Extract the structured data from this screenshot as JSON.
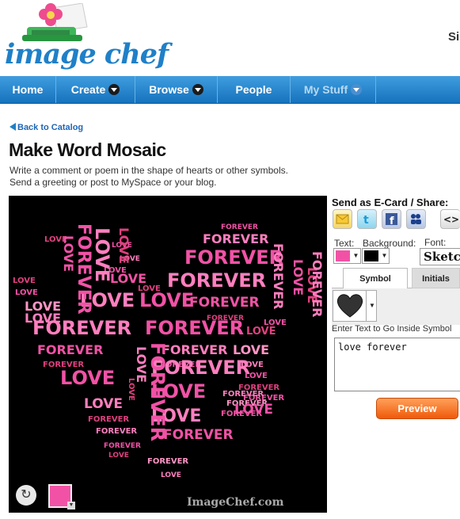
{
  "brand": {
    "logo_text": "image chef"
  },
  "header": {
    "signin_partial": "Si"
  },
  "nav": {
    "items": [
      {
        "label": "Home",
        "has_menu": false
      },
      {
        "label": "Create",
        "has_menu": true
      },
      {
        "label": "Browse",
        "has_menu": true
      },
      {
        "label": "People",
        "has_menu": false
      },
      {
        "label": "My Stuff",
        "has_menu": true
      }
    ]
  },
  "page": {
    "back_link": "Back to Catalog",
    "title": "Make Word Mosaic",
    "description_line1": "Write a comment or poem in the shape of hearts or other symbols.",
    "description_line2": "Send a greeting or post to MySpace or your blog."
  },
  "mosaic": {
    "background_color": "#000000",
    "text_color": "#f252a6",
    "words": [
      "LOVE",
      "FOREVER"
    ],
    "watermark": "ImageChef.com",
    "rotate_icon": "refresh-icon"
  },
  "panel": {
    "send_label": "Send as E-Card / Share:",
    "share_icons": [
      "email-icon",
      "twitter-icon",
      "facebook-icon",
      "myspace-icon",
      "embed-code-icon"
    ],
    "text_label": "Text:",
    "background_label": "Background:",
    "font_label": "Font:",
    "text_color": "#f252a6",
    "background_color": "#000000",
    "font_value": "Sketch",
    "tabs": [
      {
        "label": "Symbol",
        "active": true
      },
      {
        "label": "Initials",
        "active": false
      }
    ],
    "symbol_icon": "heart-icon",
    "enter_text_label": "Enter Text to Go Inside Symbol",
    "text_value": "love forever",
    "preview_label": "Preview"
  },
  "colors": {
    "nav_blue": "#1f80c8",
    "link_blue": "#1f65b5",
    "preview_orange": "#f05a0a"
  }
}
